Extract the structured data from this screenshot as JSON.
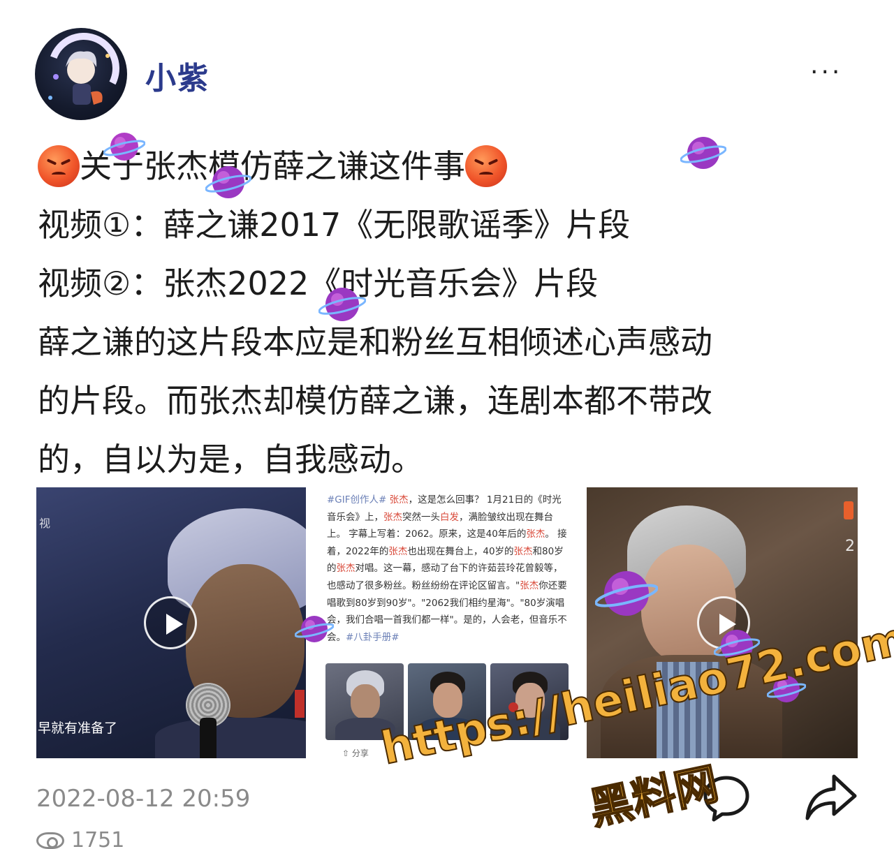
{
  "author": {
    "name": "小紫"
  },
  "header": {
    "more_label": "···"
  },
  "post": {
    "title": "关于张杰模仿薛之谦这件事",
    "lines": [
      "视频①：薛之谦2017《无限歌谣季》片段",
      "视频②：张杰2022《时光音乐会》片段",
      "薛之谦的这片段本应是和粉丝互相倾述心声感动",
      "的片段。而张杰却模仿薛之谦，连剧本都不带改",
      "的，自以为是，自我感动。"
    ]
  },
  "images": {
    "tile1_caption": "早就有准备了",
    "tile1_side": "视",
    "tile2_text": {
      "seg1": "#GIF创作人#",
      "seg2": " ",
      "seg3": "张杰",
      "seg4": "，这是怎么回事？ 1月21日的《时光音乐会》上，",
      "seg5": "张杰",
      "seg6": "突然一头",
      "seg7": "白发",
      "seg8": "，满脸皱纹出现在舞台上。 字幕上写着：2062。原来，这是40年后的",
      "seg9": "张杰",
      "seg10": "。 接着，2022年的",
      "seg11": "张杰",
      "seg12": "也出现在舞台上，40岁的",
      "seg13": "张杰",
      "seg14": "和80岁的",
      "seg15": "张杰",
      "seg16": "对唱。这一幕，感动了台下的许茹芸玲花曾毅等，也感动了很多粉丝。粉丝纷纷在评论区留言。\"",
      "seg17": "张杰",
      "seg18": "你还要唱歌到80岁到90岁\"。\"2062我们相约星海\"。\"80岁演唱会，我们合唱一首我们都一样\"。是的，人会老，但音乐不会。",
      "seg19": "#八卦手册#"
    },
    "tile2_share": "分享",
    "tile3_counter": "2"
  },
  "footer": {
    "timestamp": "2022-08-12 20:59",
    "views": "1751"
  },
  "watermark": {
    "url": "https://heiliao72.com",
    "site": "黑料网"
  },
  "colors": {
    "author": "#2b3a8c",
    "highlight": "#d94a3a",
    "tag": "#6a7fb6",
    "meta": "#8a8a8a",
    "watermark": "#f3b23d"
  }
}
